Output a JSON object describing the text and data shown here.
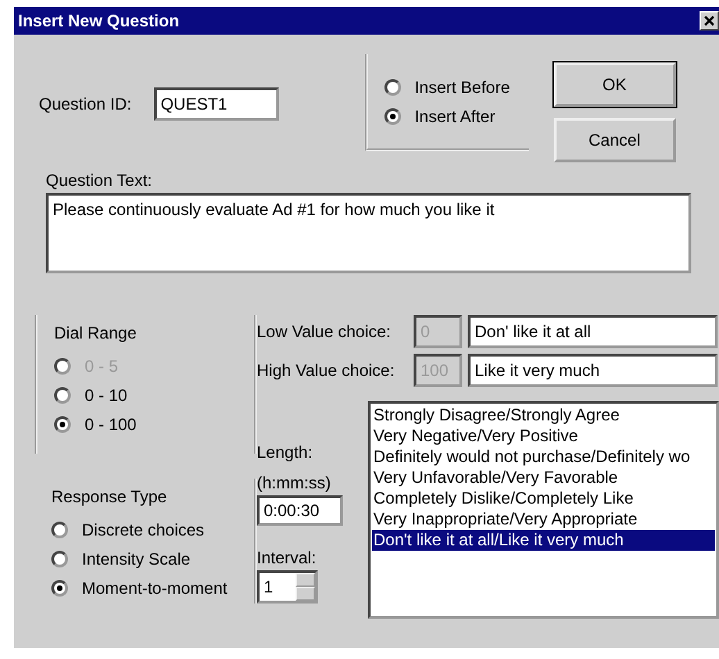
{
  "window": {
    "title": "Insert New Question"
  },
  "question_id": {
    "label": "Question ID:",
    "value": "QUEST1"
  },
  "position": [
    {
      "label": "Insert Before",
      "selected": false
    },
    {
      "label": "Insert After",
      "selected": true
    }
  ],
  "buttons": [
    {
      "label": "OK",
      "default": true
    },
    {
      "label": "Cancel",
      "default": false
    }
  ],
  "question_text": {
    "label": "Question Text:",
    "value": "Please continuously evaluate Ad #1 for how much you like it"
  },
  "dial_range": {
    "title": "Dial Range",
    "options": [
      {
        "label": "0 - 5",
        "selected": false,
        "disabled": true
      },
      {
        "label": "0 - 10",
        "selected": false,
        "disabled": false
      },
      {
        "label": "0 - 100",
        "selected": true,
        "disabled": false
      }
    ]
  },
  "value_choices": [
    {
      "label": "Low Value choice:",
      "number": "0",
      "text": "Don' like it at all"
    },
    {
      "label": "High Value choice:",
      "number": "100",
      "text": "Like it very much"
    }
  ],
  "length": {
    "label": "Length:",
    "hint": "(h:mm:ss)",
    "value": "0:00:30"
  },
  "interval": {
    "label": "Interval:",
    "value": "1"
  },
  "response_type": {
    "title": "Response Type",
    "options": [
      {
        "label": "Discrete choices",
        "selected": false
      },
      {
        "label": "Intensity Scale",
        "selected": false
      },
      {
        "label": "Moment-to-moment",
        "selected": true
      }
    ]
  },
  "scales": [
    {
      "label": "Strongly Disagree/Strongly Agree",
      "selected": false
    },
    {
      "label": "Very Negative/Very Positive",
      "selected": false
    },
    {
      "label": "Definitely would not purchase/Definitely wo",
      "selected": false
    },
    {
      "label": "Very Unfavorable/Very Favorable",
      "selected": false
    },
    {
      "label": "Completely Dislike/Completely Like",
      "selected": false
    },
    {
      "label": "Very Inappropriate/Very Appropriate",
      "selected": false
    },
    {
      "label": "Don't like it at all/Like it very much",
      "selected": true
    }
  ]
}
